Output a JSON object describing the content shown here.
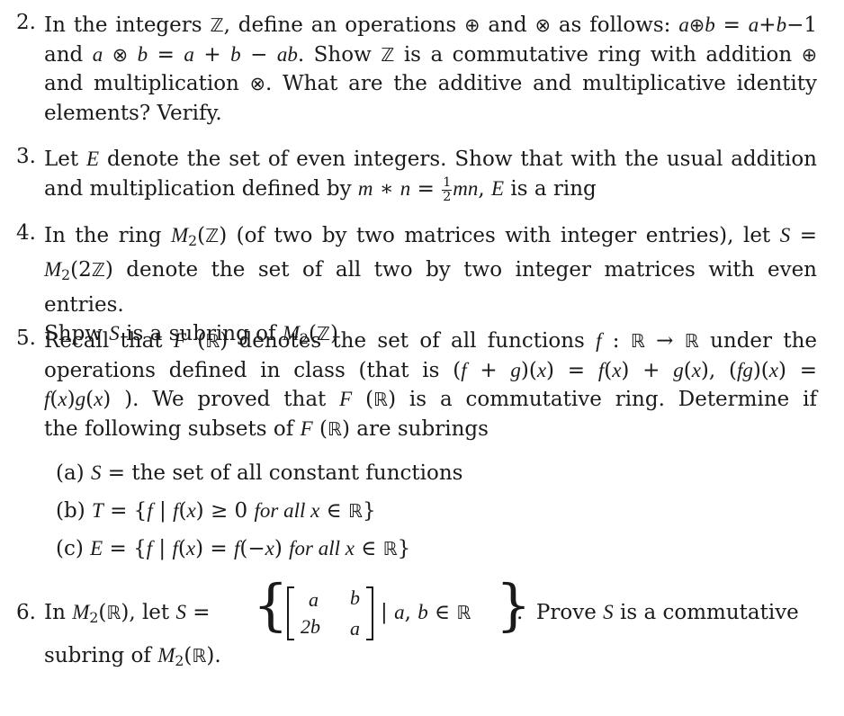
{
  "problems": [
    {
      "number": "2.",
      "lines": [
        "In the integers ℤ, define an operations ⊕ and ⊗ as follows: a⊕b = a+b−1",
        "and a ⊗ b = a + b − ab. Show ℤ is a commutative ring with addition ⊕",
        "and multiplication ⊗. What are the additive and multiplicative identity",
        "elements? Verify."
      ]
    },
    {
      "number": "3.",
      "lines": [
        "Let E denote the set of even integers. Show that with the usual addition",
        "and multiplication defined by m ∗ n = ½mn, E is a ring"
      ]
    },
    {
      "number": "4.",
      "lines": [
        "In the ring M₂(ℤ) (of two by two matrices with integer entries), let S =",
        "M₂(2ℤ) denote the set of all two by two integer matrices with even entries.",
        "Shpw S is a subring of M₂(ℤ)"
      ]
    },
    {
      "number": "5.",
      "lines": [
        "Recall that F(ℝ) denotes the set of all functions f : ℝ → ℝ under the",
        "operations defined in class (that is (f + g)(x) = f(x) + g(x), (fg)(x) =",
        "f(x)g(x) ). We proved that F(ℝ) is a commutative ring. Determine if",
        "the following subsets of F(ℝ) are subrings"
      ],
      "subitems": [
        {
          "label": "(a)",
          "text": "S = the set of all constant functions"
        },
        {
          "label": "(b)",
          "text": "T = {f | f(x) ≥ 0 for all x ∈ ℝ}"
        },
        {
          "label": "(c)",
          "text": "E = {f | f(x) = f(−x) for all x ∈ ℝ}"
        }
      ]
    },
    {
      "number": "6.",
      "prefix": "In M₂(ℝ), let S =",
      "matrix": [
        [
          "a",
          "b"
        ],
        [
          "2b",
          "a"
        ]
      ],
      "set_condition": "| a, b ∈ ℝ",
      "suffix": ". Prove S is a commutative",
      "line2": "subring of M₂(ℝ)."
    }
  ],
  "symbols": {
    "Z": "ℤ",
    "R": "ℝ",
    "oplus": "⊕",
    "otimes": "⊗",
    "minus": "−",
    "star": "∗",
    "geq": "≥",
    "in": "∈",
    "arrow": "→",
    "half_num": "1",
    "half_den": "2",
    "sub2": "2"
  }
}
